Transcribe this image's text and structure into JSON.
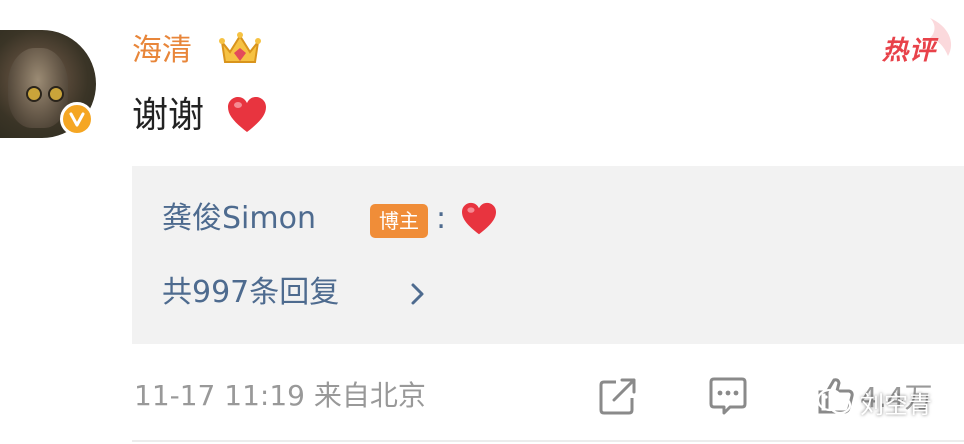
{
  "comment": {
    "username": "海清",
    "text": "谢谢",
    "hot_label": "热评",
    "timestamp": "11-17 11:19",
    "source": "来自北京",
    "like_count": "4.4万",
    "emoji": "heart"
  },
  "reply": {
    "author": "龚俊Simon",
    "badge": "博主",
    "colon": ":",
    "emoji": "heart",
    "count_text": "共997条回复"
  },
  "watermark": {
    "text": "刘空青"
  },
  "colors": {
    "username": "#e8863a",
    "link_blue": "#4e6b8f",
    "badge_orange": "#f08d38",
    "hot_red": "#e8424a",
    "meta_grey": "#999999",
    "reply_bg": "#f2f2f2"
  }
}
